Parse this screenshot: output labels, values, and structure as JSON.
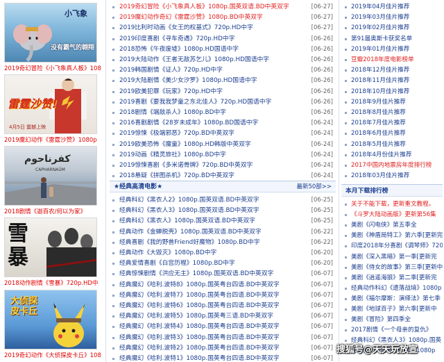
{
  "posters": [
    {
      "caption": "2019奇幻冒险《小飞象真人板》108",
      "title": "小飞象",
      "subtitle": "没有霸气的翱翔",
      "bg": "#7fb6da"
    },
    {
      "caption": "2019魔幻动作《雷霆沙赞》1080p",
      "title": "雷霆沙赞!",
      "subtitle": "4月5日 震撼上映",
      "bg": "#c7372b"
    },
    {
      "caption": "2018剧情《迦百农/何以为家》",
      "title": "كفرناحوم",
      "subtitle": "CAPHARNAÜM",
      "bg": "#6c87a4"
    },
    {
      "caption": "2018动作剧情《雪暴》720p.HD中",
      "title": "雪暴",
      "subtitle": "",
      "bg": "#e9e6e0"
    },
    {
      "caption": "2019奇幻动作《大侦探皮卡丘》108",
      "title": "大侦探 皮卡丘",
      "subtitle": "",
      "bg": "#5b9ad6"
    }
  ],
  "latest_list": [
    {
      "text": "2019奇幻冒险《小飞象真人板》1080p.国英双语.BD中英双字",
      "date": "[06-27]",
      "red": true
    },
    {
      "text": "2019魔幻动作奇幻《雷霆沙赞》1080p.BD中英双字",
      "date": "[06-27]",
      "red": true
    },
    {
      "text": "2019比利时动画《女王的权基式》720p.HD中字",
      "date": "[06-27]",
      "red": false
    },
    {
      "text": "2019印度喜剧《寻车奇遇》720p.HD中字",
      "date": "[06-26]",
      "red": false
    },
    {
      "text": "2018恐怖《午夜废墟》1080p.HD国语中字",
      "date": "[06-26]",
      "red": false
    },
    {
      "text": "2019大陆动作《王者无敌苏乞儿》1080p.HD国语中字",
      "date": "[06-26]",
      "red": false
    },
    {
      "text": "2019韩国剧情《证人》720p.HD中字",
      "date": "[06-26]",
      "red": false
    },
    {
      "text": "2019大陆剧情《美少女汐罗》1080p.HD国语中字",
      "date": "[06-26]",
      "red": false
    },
    {
      "text": "2019欧美犯罪《玩家》720p.HD中字",
      "date": "[06-26]",
      "red": false
    },
    {
      "text": "2019喜剧《要我我梦童之东北佳人》720p.HD国语中字",
      "date": "[06-26]",
      "red": false
    },
    {
      "text": "2018剧情《端敌杀人》1080p.BD中字",
      "date": "[06-26]",
      "red": false
    },
    {
      "text": "2016喜剧剧情《28岁未成年》1080p.BD国语中字",
      "date": "[06-24]",
      "red": false
    },
    {
      "text": "2019惊悚《极端邪恶》720p.BD中英双字",
      "date": "[06-24]",
      "red": false
    },
    {
      "text": "2019欧美恐怖《魔童》1080p.HD韩版中英双字",
      "date": "[06-24]",
      "red": false
    },
    {
      "text": "2019动画《精灵旅社》1080p.BD中字",
      "date": "[06-24]",
      "red": false
    },
    {
      "text": "2019惊悚喜剧《多米诺骨牌》720p.BD中英双字",
      "date": "[06-24]",
      "red": false
    },
    {
      "text": "2018悬疑《拼图杀机》720p.BD中英双字",
      "date": "[06-24]",
      "red": false
    }
  ],
  "classic_section": {
    "title": "★经典高清电影★",
    "more": "最新50部>>"
  },
  "classic_list": [
    {
      "text": "经典科幻《黑衣人2》1080p.国英双语.BD中英双字",
      "date": "[06-25]"
    },
    {
      "text": "经典科幻《黑衣人3》1080p.国英双语.BD中英双字",
      "date": "[06-25]"
    },
    {
      "text": "经典科幻《黑衣人》1080p.国英双语.BD中英双字",
      "date": "[06-25]"
    },
    {
      "text": "经典动作《金蝉脱壳》1080p.国英双语.BD中英双字",
      "date": "[06-22]"
    },
    {
      "text": "经典喜剧《我的野兽Friend好魔物》1080p.BD中字",
      "date": "[06-22]"
    },
    {
      "text": "经典动作《大毁灭》1080p.BD中字",
      "date": "[06-20]"
    },
    {
      "text": "经典爱情喜剧《白宫历程》1080p.BD中字",
      "date": "[06-20]"
    },
    {
      "text": "经典惊悚剧情《洪应无主》1080p.国英双语.BD中英双字",
      "date": "[06-07]"
    },
    {
      "text": "经典魔幻《哈利.波特8》1080p.国英粤台四语.BD中英双字",
      "date": "[06-07]"
    },
    {
      "text": "经典魔幻《哈利.波特7》1080p.国英粤台四语.BD中英双字",
      "date": "[06-07]"
    },
    {
      "text": "经典魔幻《哈利.波特6》1080p.国英粤台四语.BD中英双字",
      "date": "[06-07]"
    },
    {
      "text": "经典魔幻《哈利.波特5》1080p.国英粤三语.BD中英双字",
      "date": "[06-07]"
    },
    {
      "text": "经典魔幻《哈利.波特4》1080p.国英粤台四语.BD中英双字",
      "date": "[06-07]"
    },
    {
      "text": "经典魔幻《哈利.波特3》1080p.国英粤台四语.BD中英双字",
      "date": "[06-07]"
    },
    {
      "text": "经典魔幻《哈利.波特2》1080p.国英粤台四语.BD中英双字",
      "date": "[06-07]"
    },
    {
      "text": "经典魔幻《哈利.波特1》1080p.国英粤台四语.BD中英双字",
      "date": "[06-07]"
    }
  ],
  "recommend_list": [
    {
      "text": "2019年04月佳片推荐",
      "red": false
    },
    {
      "text": "2019年03月佳片推荐",
      "red": false
    },
    {
      "text": "2019年02月佳片推荐",
      "red": false
    },
    {
      "text": "第91届奥斯卡获奖名单",
      "red": false
    },
    {
      "text": "2019年01月佳片推荐",
      "red": false
    },
    {
      "text": "豆瓣2018年度电影榜单",
      "red": true
    },
    {
      "text": "2018年12月佳片推荐",
      "red": false
    },
    {
      "text": "2018年11月佳片推荐",
      "red": false
    },
    {
      "text": "2018年10月佳片推荐",
      "red": false
    },
    {
      "text": "2018年9月佳片推荐",
      "red": false
    },
    {
      "text": "2018年8月佳片推荐",
      "red": false
    },
    {
      "text": "2018年7月佳片推荐",
      "red": false
    },
    {
      "text": "2018年6月佳片推荐",
      "red": false
    },
    {
      "text": "2018年5月佳片推荐",
      "red": false
    },
    {
      "text": "2018年4月份佳片推荐",
      "red": false
    },
    {
      "text": "2017中国内地票房年度排行榜",
      "red": true
    },
    {
      "text": "2018年03月佳片推荐",
      "red": false
    }
  ],
  "rank_section": {
    "title": "本月下载排行榜"
  },
  "rank_list": [
    {
      "text": "关于不能下载，更新重文教程。",
      "red": true
    },
    {
      "text": "《斗罗大陆动画版》更新第56集",
      "red": true
    },
    {
      "text": "美剧《闪电侠》第五季全",
      "red": false
    },
    {
      "text": "美剧《神盾局特工》第六季[更新完",
      "red": false
    },
    {
      "text": "印度2018年分喜剧《调琴师》720p",
      "red": false
    },
    {
      "text": "美剧《深入黑暗》第一季[更新完",
      "red": false
    },
    {
      "text": "美剧《侍女的故事》第三季[更新中",
      "red": false
    },
    {
      "text": "美剧《逍遥海狼》第二季[更新完",
      "red": false
    },
    {
      "text": "经典动作科幻《遗落战境》1080p",
      "red": false
    },
    {
      "text": "美剧《福尔摩斯：演绎法》第七季",
      "red": false
    },
    {
      "text": "美剧《地球百子》第六季[更新中",
      "red": false
    },
    {
      "text": "美剧《冒险》第四季全",
      "red": false
    },
    {
      "text": "2017剧情《一个母亲的复仇》",
      "red": false
    },
    {
      "text": "经典科幻《黑衣人3》1080p.国英",
      "red": false
    },
    {
      "text": "经典魔幻《哈利.波特1》1080p",
      "red": false
    }
  ],
  "watermark": "搜狐号@天天玩放宣",
  "colors": {
    "link_blue": "#1a3d8f",
    "highlight_red": "#e02020",
    "date_gray": "#666666",
    "divider": "#d9e2f0"
  }
}
